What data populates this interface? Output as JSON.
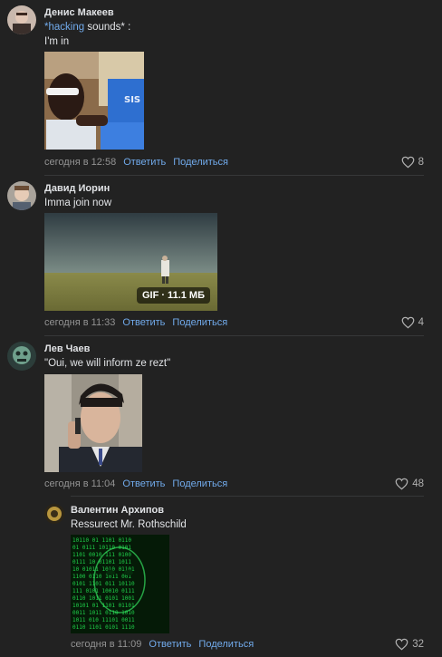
{
  "comments": [
    {
      "author": "Денис Макеев",
      "text_prefix": "*hacking",
      "text_suffix": " sounds* :",
      "text2": "I'm in",
      "time": "сегодня в 12:58",
      "reply": "Ответить",
      "share": "Поделиться",
      "likes": "8"
    },
    {
      "author": "Давид Иорин",
      "text": "Imma join now",
      "gif_badge": "GIF · 11.1 МБ",
      "time": "сегодня в 11:33",
      "reply": "Ответить",
      "share": "Поделиться",
      "likes": "4"
    },
    {
      "author": "Лев Чаев",
      "text": "\"Oui, we will inform ze rezt\"",
      "time": "сегодня в 11:04",
      "reply": "Ответить",
      "share": "Поделиться",
      "likes": "48"
    },
    {
      "author": "Валентин Архипов",
      "text": "Ressurect Mr. Rothschild",
      "time": "сегодня в 11:09",
      "reply": "Ответить",
      "share": "Поделиться",
      "likes": "32"
    }
  ],
  "icons": {
    "like": "heart-icon"
  },
  "colors": {
    "background": "#222222",
    "link": "#71aaeb",
    "meta": "#939393"
  }
}
